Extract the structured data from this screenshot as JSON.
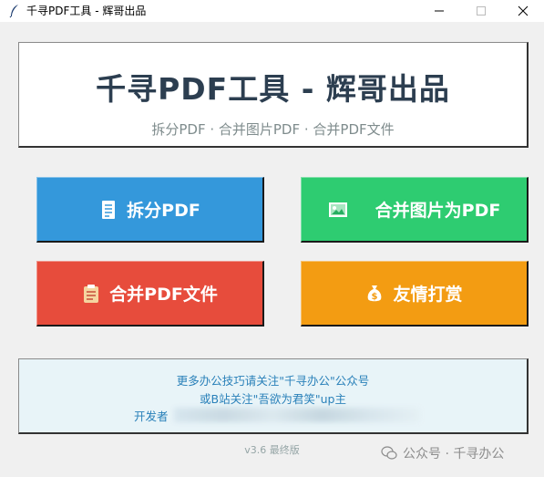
{
  "window": {
    "title": "千寻PDF工具 - 辉哥出品"
  },
  "header": {
    "title": "千寻PDF工具 - 辉哥出品",
    "subtitle": "拆分PDF · 合并图片PDF · 合并PDF文件"
  },
  "buttons": {
    "split": {
      "label": "拆分PDF",
      "icon": "document-icon",
      "color": "#3498db"
    },
    "images_to_pdf": {
      "label": "合并图片为PDF",
      "icon": "image-icon",
      "color": "#2ecc71"
    },
    "merge_pdf": {
      "label": "合并PDF文件",
      "icon": "clipboard-icon",
      "color": "#e74c3c"
    },
    "donate": {
      "label": "友情打赏",
      "icon": "money-bag-icon",
      "color": "#f39c12"
    }
  },
  "info": {
    "line1": "更多办公技巧请关注\"千寻办公\"公众号",
    "line2": "或B站关注\"吾欲为君笑\"up主",
    "line3": "开发者"
  },
  "footer": {
    "version": "v3.6 最终版"
  },
  "watermark": {
    "text": "公众号 · 千寻办公"
  }
}
